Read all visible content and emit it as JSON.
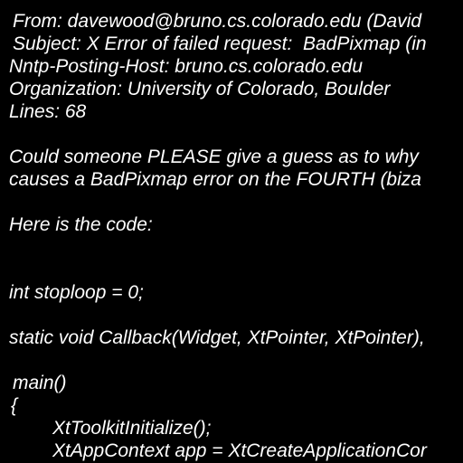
{
  "message": {
    "header": {
      "from": "From: davewood@bruno.cs.colorado.edu (David",
      "subject": "Subject: X Error of failed request:  BadPixmap (in",
      "nntp_posting_host": "Nntp-Posting-Host: bruno.cs.colorado.edu",
      "organization": "Organization: University of Colorado, Boulder",
      "lines": "Lines: 68"
    },
    "body": {
      "para1_line1": "Could someone PLEASE give a guess as to why",
      "para1_line2": "causes a BadPixmap error on the FOURTH (biza",
      "para2": "Here is the code:",
      "code_stoploop": "int stoploop = 0;",
      "code_callback": "static void Callback(Widget, XtPointer, XtPointer),",
      "code_main": "main()",
      "code_open_brace": "{",
      "code_toolkit_init": "XtToolkitInitialize();",
      "code_app_context": "XtAppContext app = XtCreateApplicationCor"
    }
  },
  "colors": {
    "background": "#000000",
    "text": "#ffffff"
  }
}
